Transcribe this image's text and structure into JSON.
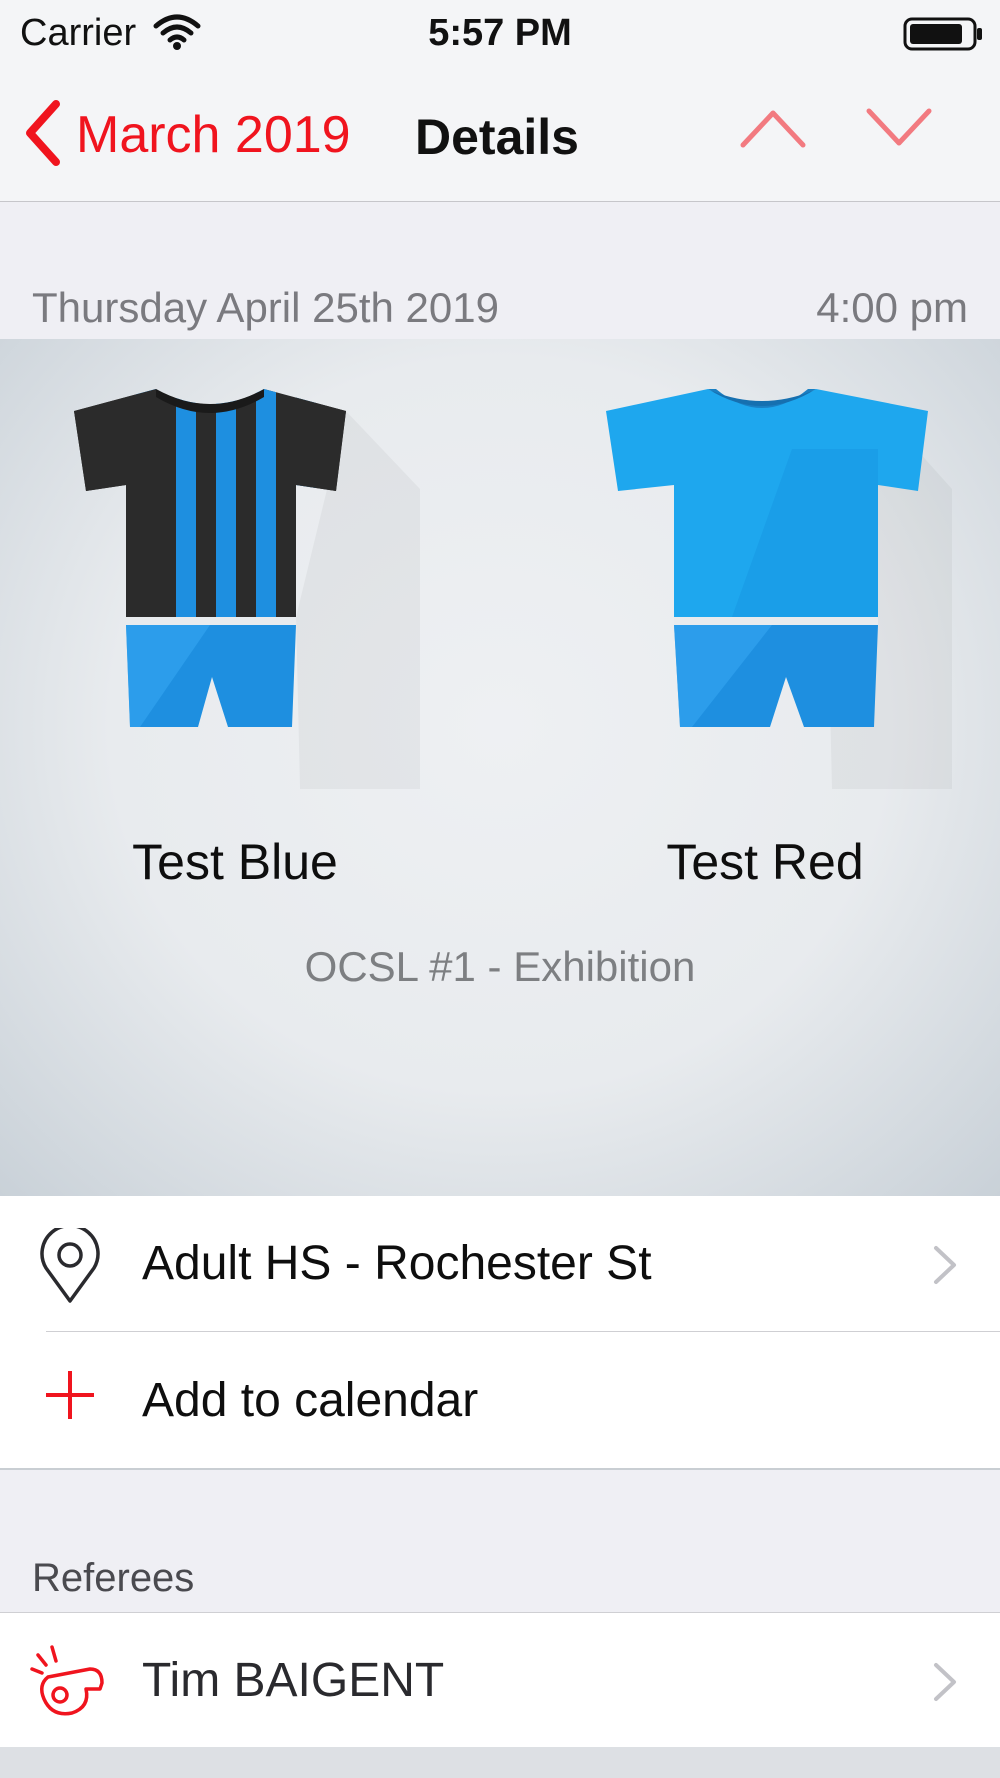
{
  "status_bar": {
    "carrier": "Carrier",
    "time": "5:57 PM",
    "icons": [
      "wifi-icon",
      "battery-icon"
    ]
  },
  "nav": {
    "back_label": "March 2019",
    "title": "Details",
    "icons": [
      "chevron-left-icon",
      "chevron-up-icon",
      "chevron-down-icon"
    ]
  },
  "match": {
    "date": "Thursday April 25th 2019",
    "time": "4:00 pm",
    "home_team": "Test Blue",
    "away_team": "Test Red",
    "competition": "OCSL #1 - Exhibition",
    "home_kit": {
      "shirt_color": "#1e8fe0",
      "stripe_color": "#2b2b2b",
      "shorts_color": "#1e8fe0",
      "pattern": "vertical-stripes"
    },
    "away_kit": {
      "shirt_color": "#1ea7ee",
      "shorts_color": "#1e8fe0",
      "pattern": "plain"
    }
  },
  "actions": [
    {
      "label": "Adult HS - Rochester St",
      "icon": "location-pin-icon",
      "has_chevron": true
    },
    {
      "label": "Add to calendar",
      "icon": "plus-icon",
      "has_chevron": false
    }
  ],
  "referees": {
    "header": "Referees",
    "items": [
      {
        "name": "Tim BAIGENT",
        "icon": "whistle-icon",
        "has_chevron": true
      }
    ]
  },
  "colors": {
    "accent": "#f0141e",
    "nav_chevron": "#f27a80",
    "background": "#efeff4"
  }
}
